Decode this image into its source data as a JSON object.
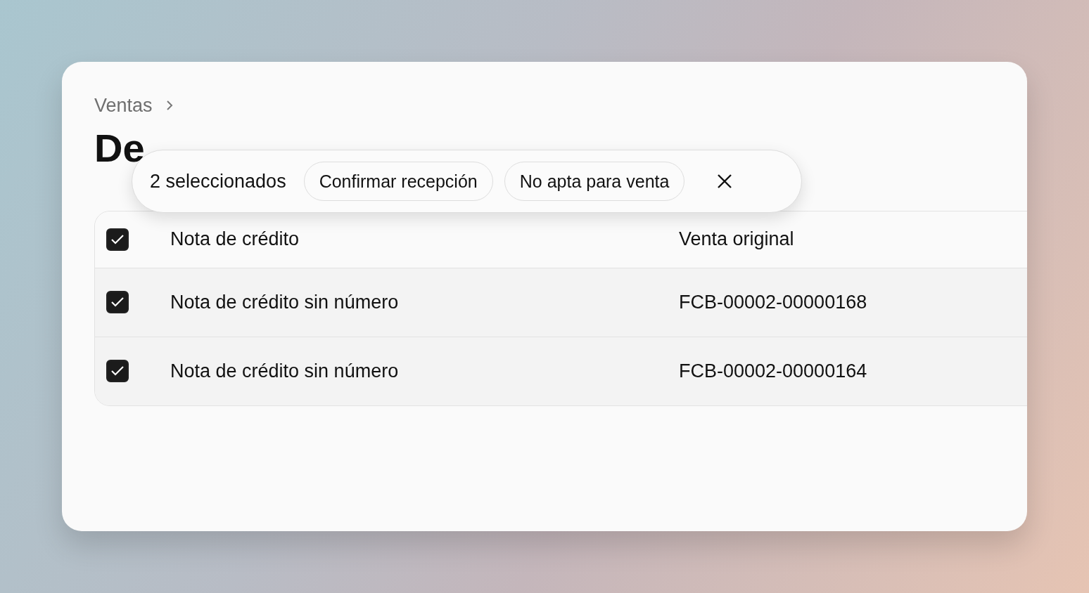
{
  "breadcrumb": {
    "items": [
      "Ventas"
    ]
  },
  "page_title": "De",
  "selection_bar": {
    "count_label": "2 seleccionados",
    "actions": [
      "Confirmar recepción",
      "No apta para venta"
    ]
  },
  "table": {
    "header": {
      "checked": true,
      "columns": [
        "Nota de crédito",
        "Venta original"
      ]
    },
    "rows": [
      {
        "checked": true,
        "cells": [
          "Nota de crédito sin número",
          "FCB-00002-00000168"
        ]
      },
      {
        "checked": true,
        "cells": [
          "Nota de crédito sin número",
          "FCB-00002-00000164"
        ]
      }
    ]
  }
}
